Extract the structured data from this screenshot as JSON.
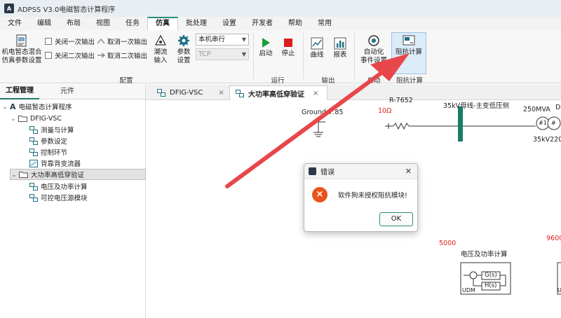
{
  "app": {
    "title": "ADPSS V3.0电磁暂态计算程序",
    "logo_text": "A"
  },
  "menu": {
    "tabs": [
      "文件",
      "编辑",
      "布局",
      "视图",
      "任务",
      "仿真",
      "批处理",
      "设置",
      "开发者",
      "帮助",
      "常用"
    ],
    "active": "仿真"
  },
  "ribbon": {
    "config": {
      "init_btn_label": "机电暂态混合\n仿真参数设置",
      "close_once": "关闭一次输出",
      "close_twice": "关闭二次输出",
      "cancel_once": "取消一次输出",
      "cancel_twice": "取消二次输出",
      "flow_input": "潮流\n输入",
      "param_settings": "参数\n设置",
      "mode_select": "本机串行",
      "protocol_select": "TCP",
      "group_label": "配置"
    },
    "run": {
      "start": "启动",
      "stop": "停止",
      "group_label": "运行"
    },
    "output": {
      "curve": "曲线",
      "report": "报表",
      "group_label": "输出"
    },
    "auto": {
      "label": "自动化\n事件设置",
      "group_label": "自动"
    },
    "impedance": {
      "label": "阻抗计算",
      "group_label": "阻抗计算"
    }
  },
  "left_panel": {
    "tabs": [
      "工程管理",
      "元件"
    ],
    "tree": {
      "root": "电磁暂态计算程序",
      "nodes": [
        {
          "label": "DFIG-VSC",
          "children": [
            "测量与计算",
            "参数设定",
            "控制环节",
            "背靠背变流器"
          ]
        },
        {
          "label": "大功率高低穿验证",
          "children": [
            "电压及功率计算",
            "可控电压源模块"
          ]
        }
      ]
    }
  },
  "doc_tabs": [
    {
      "label": "DFIG-VSC",
      "close": "×"
    },
    {
      "label": "大功率高低穿验证",
      "close": "×"
    }
  ],
  "canvas": {
    "ground_label": "Ground-7.85",
    "r_label": "R-7652",
    "resistance": "10Ω",
    "bus_label": "35kV母线-主变低压侧",
    "mva_label": "250MVA",
    "partial_label": "D",
    "transformer_label": "35kV220k",
    "t1": "#1",
    "t2": "#",
    "value_5000": "5000",
    "value_9600": "9600",
    "block_title": "电压及功率计算",
    "block_g": "G(s)",
    "block_h": "H(s)",
    "block_udm": "UDM",
    "block2_udm": "UD"
  },
  "dialog": {
    "title": "错误",
    "message": "软件狗未授权阻抗模块!",
    "ok": "OK",
    "close": "✕",
    "error_icon": "×"
  },
  "colors": {
    "accent": "#2a8f7a",
    "error": "#e8541c",
    "arrow": "#e8474a",
    "bus": "#1a7a6a"
  }
}
